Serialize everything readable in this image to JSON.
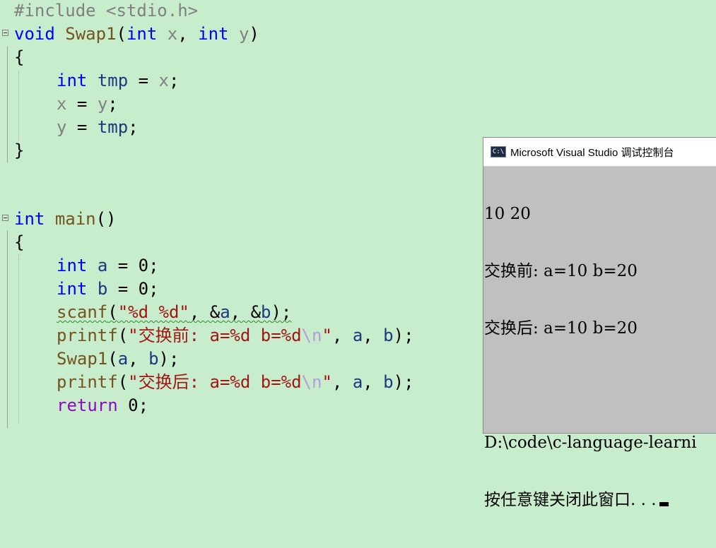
{
  "editor": {
    "lines": {
      "l1": {
        "text": "#include <stdio.h>"
      },
      "l2": {
        "kw": "void",
        "name": "Swap1",
        "open": "(",
        "t1": "int",
        "p1": "x",
        "comma": ", ",
        "t2": "int",
        "p2": "y",
        "close": ")"
      },
      "l3": {
        "text": "{"
      },
      "l4": {
        "kw": "int",
        "name": "tmp",
        "op": " = ",
        "rhs": "x",
        "end": ";"
      },
      "l5": {
        "lhs": "x",
        "op": " = ",
        "rhs": "y",
        "end": ";"
      },
      "l6": {
        "lhs": "y",
        "op": " = ",
        "rhs": "tmp",
        "end": ";"
      },
      "l7": {
        "text": "}"
      },
      "l8": {
        "kw": "int",
        "name": "main",
        "rest": "()"
      },
      "l9": {
        "text": "{"
      },
      "l10": {
        "kw": "int",
        "name": "a",
        "rest": " = 0;"
      },
      "l11": {
        "kw": "int",
        "name": "b",
        "rest": " = 0;"
      },
      "l12": {
        "fn": "scanf",
        "open": "(",
        "str": "\"%d %d\"",
        "mid": ", &",
        "a": "a",
        "sep": ", &",
        "b": "b",
        "close": ");"
      },
      "l13": {
        "fn": "printf",
        "open": "(",
        "str": "\"交换前: a=%d b=%d",
        "esc": "\\n",
        "strend": "\"",
        "sep1": ", ",
        "a": "a",
        "sep2": ", ",
        "b": "b",
        "close": ");"
      },
      "l14": {
        "fn": "Swap1",
        "open": "(",
        "a": "a",
        "sep": ", ",
        "b": "b",
        "close": ");"
      },
      "l15": {
        "fn": "printf",
        "open": "(",
        "str": "\"交换后: a=%d b=%d",
        "esc": "\\n",
        "strend": "\"",
        "sep1": ", ",
        "a": "a",
        "sep2": ", ",
        "b": "b",
        "close": ");"
      },
      "l16": {
        "kw": "return",
        "rest": " 0;"
      }
    }
  },
  "console": {
    "icon_text": "C:\\",
    "title": "Microsoft Visual Studio 调试控制台",
    "output": {
      "line1": "10 20",
      "line2": "交换前: a=10 b=20",
      "line3": "交换后: a=10 b=20",
      "line4": "",
      "line5": "D:\\code\\c-language-learni",
      "line6": "按任意键关闭此窗口. . ."
    }
  },
  "colors": {
    "background": "#c7edcc",
    "keyword": "#0000ff",
    "function": "#74531f",
    "string": "#a31515",
    "variable": "#1f377f",
    "parameter": "#808080"
  }
}
